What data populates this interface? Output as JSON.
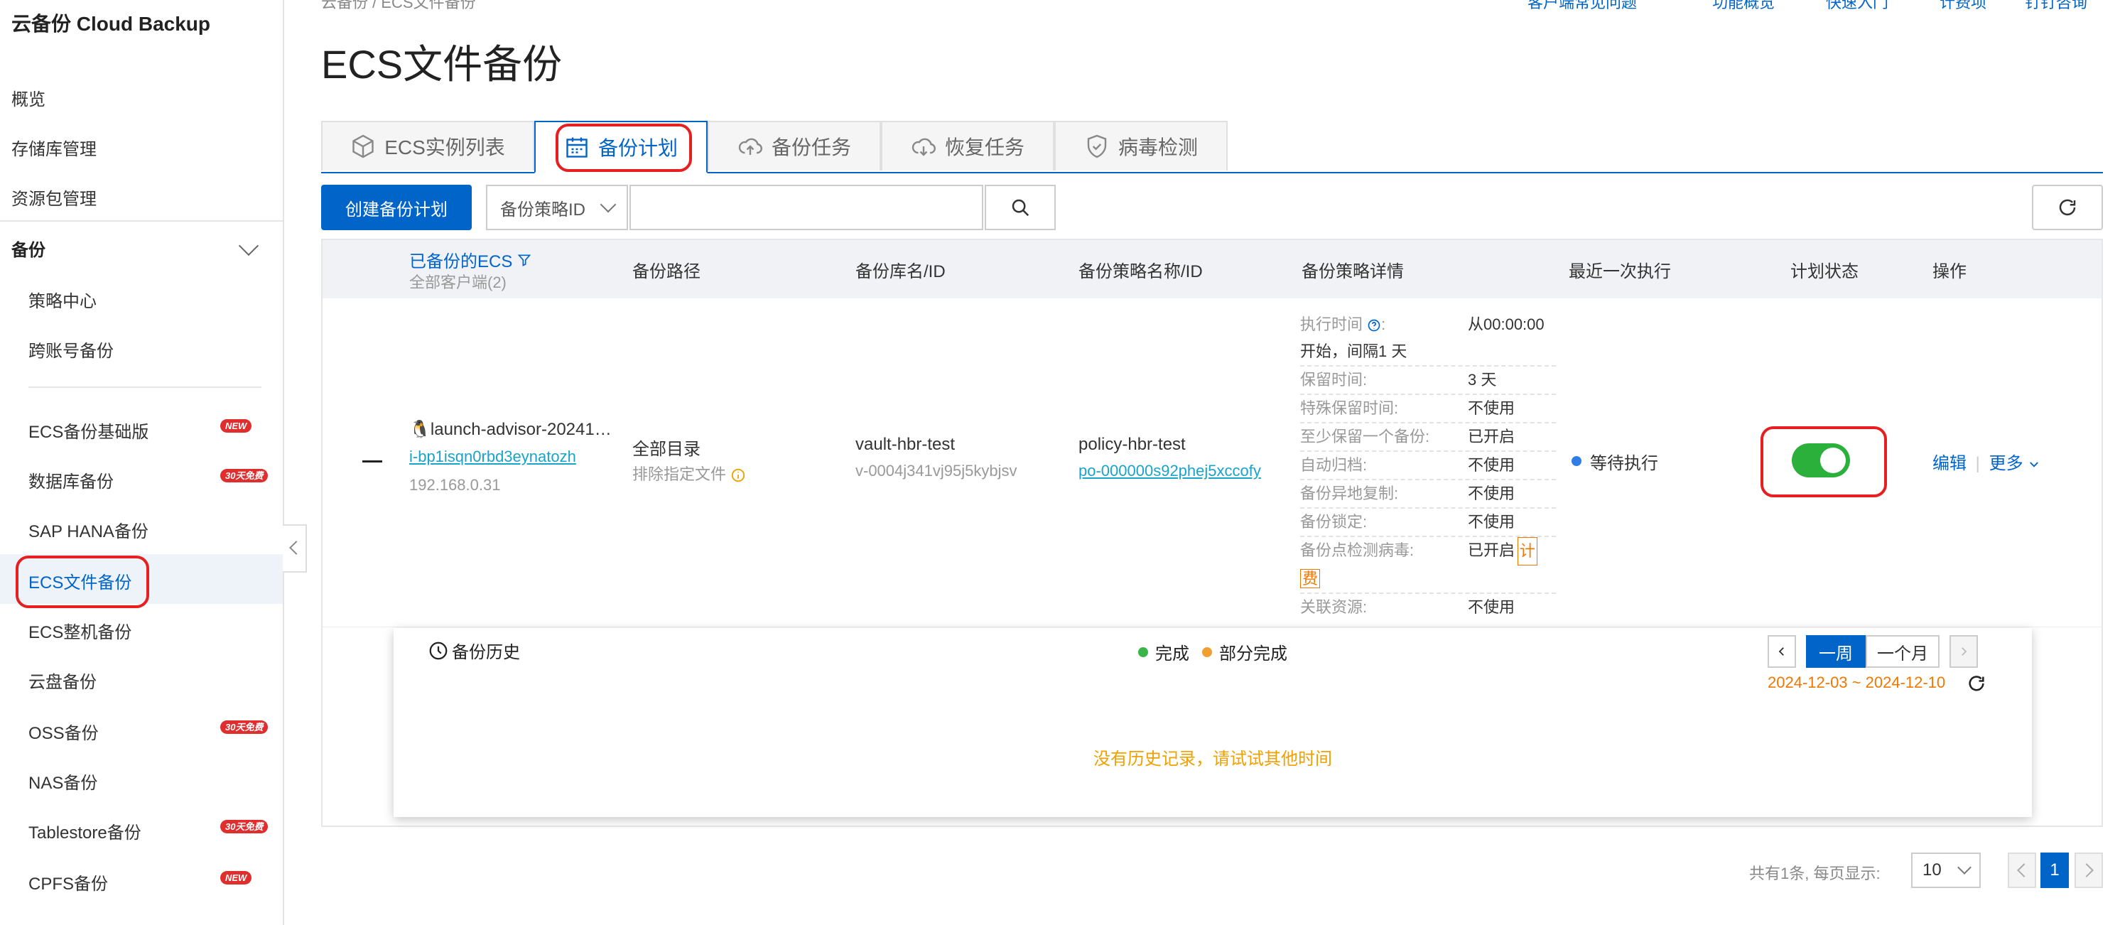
{
  "sidebar": {
    "brand": "云备份 Cloud Backup",
    "overview": "概览",
    "vault_mgmt": "存储库管理",
    "package_mgmt": "资源包管理",
    "group_backup": "备份",
    "policy_center": "策略中心",
    "cross_account": "跨账号备份",
    "items": [
      {
        "label": "ECS备份基础版",
        "badge": "NEW"
      },
      {
        "label": "数据库备份",
        "badge": "30天免费"
      },
      {
        "label": "SAP HANA备份",
        "badge": ""
      },
      {
        "label": "ECS文件备份",
        "badge": ""
      },
      {
        "label": "ECS整机备份",
        "badge": ""
      },
      {
        "label": "云盘备份",
        "badge": ""
      },
      {
        "label": "OSS备份",
        "badge": "30天免费"
      },
      {
        "label": "NAS备份",
        "badge": ""
      },
      {
        "label": "Tablestore备份",
        "badge": "30天免费"
      },
      {
        "label": "CPFS备份",
        "badge": "NEW"
      }
    ]
  },
  "header": {
    "breadcrumb": "云备份 / ECS文件备份",
    "links": [
      "客户端常见问题",
      "功能概览",
      "快速入门",
      "计费项",
      "钉钉咨询"
    ],
    "title": "ECS文件备份"
  },
  "tabs": [
    "ECS实例列表",
    "备份计划",
    "备份任务",
    "恢复任务",
    "病毒检测"
  ],
  "toolbar": {
    "create_label": "创建备份计划",
    "filter_select": "备份策略ID",
    "search_placeholder": ""
  },
  "table": {
    "headers": {
      "ecs": "已备份的ECS",
      "ecs_sub": "全部客户端(2)",
      "path": "备份路径",
      "vault": "备份库名/ID",
      "policy": "备份策略名称/ID",
      "detail": "备份策略详情",
      "last": "最近一次执行",
      "state": "计划状态",
      "ops": "操作"
    },
    "row": {
      "ecs_name": "launch-advisor-20241…",
      "ecs_id": "i-bp1isqn0rbd3eynatozh",
      "ecs_ip": "192.168.0.31",
      "path": "全部目录",
      "path_sub": "排除指定文件",
      "vault_name": "vault-hbr-test",
      "vault_id": "v-0004j341vj95j5kybjsv",
      "policy_name": "policy-hbr-test",
      "policy_id": "po-000000s92phej5xccofy",
      "detail": {
        "exec_time_key": "执行时间",
        "exec_time_val": "从00:00:00",
        "exec_time_val2": "开始，间隔1 天",
        "rows": [
          {
            "k": "保留时间:",
            "v": "3 天"
          },
          {
            "k": "特殊保留时间:",
            "v": "不使用"
          },
          {
            "k": "至少保留一个备份:",
            "v": "已开启"
          },
          {
            "k": "自动归档:",
            "v": "不使用"
          },
          {
            "k": "备份异地复制:",
            "v": "不使用"
          },
          {
            "k": "备份锁定:",
            "v": "不使用"
          }
        ],
        "virus_key": "备份点检测病毒:",
        "virus_val": "已开启",
        "virus_fee1": "计",
        "virus_fee2": "费",
        "assoc_key": "关联资源:",
        "assoc_val": "不使用"
      },
      "last_exec": "等待执行",
      "plan_enabled": true,
      "op_edit": "编辑",
      "op_more": "更多"
    }
  },
  "history": {
    "title": "备份历史",
    "legend_done": "完成",
    "legend_partial": "部分完成",
    "week": "一周",
    "month": "一个月",
    "date_range": "2024-12-03 ~ 2024-12-10",
    "empty": "没有历史记录，请试试其他时间"
  },
  "pagination": {
    "summary": "共有1条, 每页显示:",
    "page_size": "10",
    "current": "1"
  },
  "colors": {
    "primary": "#0064c8",
    "highlight": "#e62020",
    "toggle_on": "#2bb03b",
    "warning": "#f07800"
  }
}
